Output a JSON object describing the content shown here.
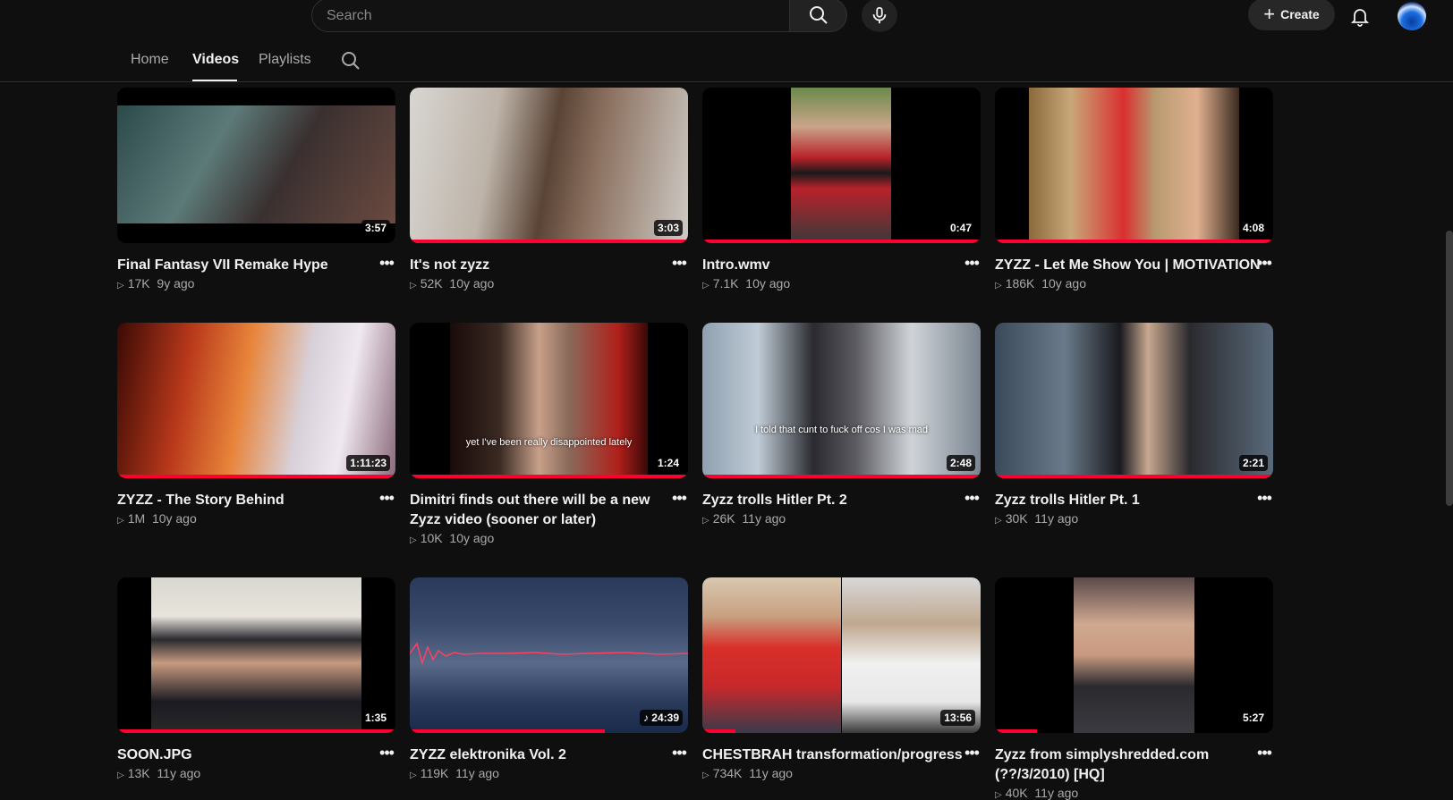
{
  "search": {
    "placeholder": "Search"
  },
  "header": {
    "create_label": "Create"
  },
  "tabs": [
    {
      "label": "Home"
    },
    {
      "label": "Videos"
    },
    {
      "label": "Playlists"
    }
  ],
  "videos": [
    {
      "title": "Final Fantasy VII Remake Hype",
      "views": "17K",
      "age": "9y ago",
      "duration": "3:57"
    },
    {
      "title": "It's not zyzz",
      "views": "52K",
      "age": "10y ago",
      "duration": "3:03"
    },
    {
      "title": "Intro.wmv",
      "views": "7.1K",
      "age": "10y ago",
      "duration": "0:47"
    },
    {
      "title": "ZYZZ - Let Me Show You | MOTIVATION",
      "views": "186K",
      "age": "10y ago",
      "duration": "4:08"
    },
    {
      "title": "ZYZZ - The Story Behind",
      "views": "1M",
      "age": "10y ago",
      "duration": "1:11:23"
    },
    {
      "title": "Dimitri finds out there will be a new Zyzz video (sooner or later)",
      "views": "10K",
      "age": "10y ago",
      "duration": "1:24",
      "caption": "yet I've been really disappointed lately"
    },
    {
      "title": "Zyzz trolls Hitler Pt. 2",
      "views": "26K",
      "age": "11y ago",
      "duration": "2:48",
      "caption": "I told that cunt to fuck off cos I was mad"
    },
    {
      "title": "Zyzz trolls Hitler Pt. 1",
      "views": "30K",
      "age": "11y ago",
      "duration": "2:21"
    },
    {
      "title": "SOON.JPG",
      "views": "13K",
      "age": "11y ago",
      "duration": "1:35"
    },
    {
      "title": "ZYZZ elektronika Vol. 2",
      "views": "119K",
      "age": "11y ago",
      "duration": "♪ 24:39"
    },
    {
      "title": "CHESTBRAH transformation/progress",
      "views": "734K",
      "age": "11y ago",
      "duration": "13:56"
    },
    {
      "title": "Zyzz from simplyshredded.com (??/3/2010) [HQ]",
      "views": "40K",
      "age": "11y ago",
      "duration": "5:27"
    }
  ]
}
